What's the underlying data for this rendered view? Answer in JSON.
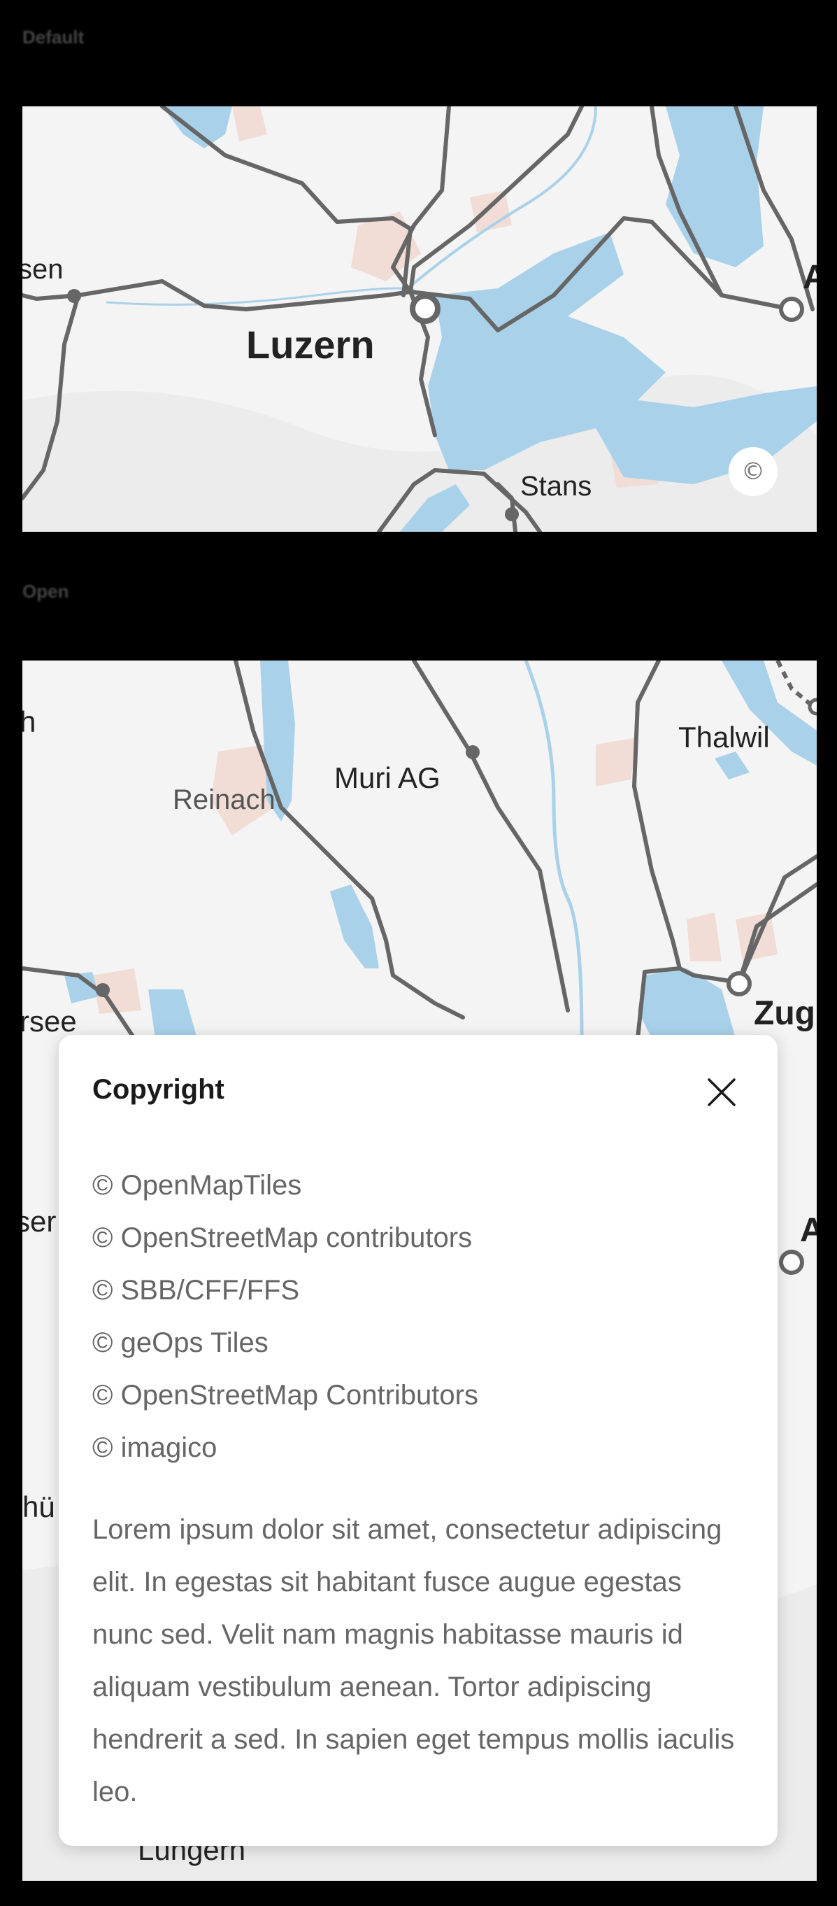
{
  "sections": [
    {
      "label": "Default"
    },
    {
      "label": "Open"
    }
  ],
  "map_default": {
    "labels": [
      "Luzern",
      "Stans",
      "sen",
      "A"
    ],
    "copyright_button": "©"
  },
  "map_open": {
    "labels": [
      "Thalwil",
      "Muri AG",
      "Reinach",
      "Zug",
      "rsee",
      "h",
      "ser",
      "hü",
      "A",
      "Lungern"
    ]
  },
  "dialog": {
    "title": "Copyright",
    "attributions": [
      "© OpenMapTiles",
      "© OpenStreetMap contributors",
      "© SBB/CFF/FFS",
      "© geOps Tiles",
      "© OpenStreetMap Contributors",
      "© imagico"
    ],
    "body": "Lorem ipsum dolor sit amet, consectetur adipiscing elit. In egestas sit habitant fusce augue egestas nunc sed. Velit nam magnis habitasse mauris id aliquam vestibulum aenean. Tortor adipiscing hendrerit a sed. In sapien eget tempus mollis iaculis leo."
  },
  "colors": {
    "water": "#a9d2ea",
    "rail": "#666666",
    "land": "#f4f4f4",
    "settlement": "#f1ddd6"
  }
}
